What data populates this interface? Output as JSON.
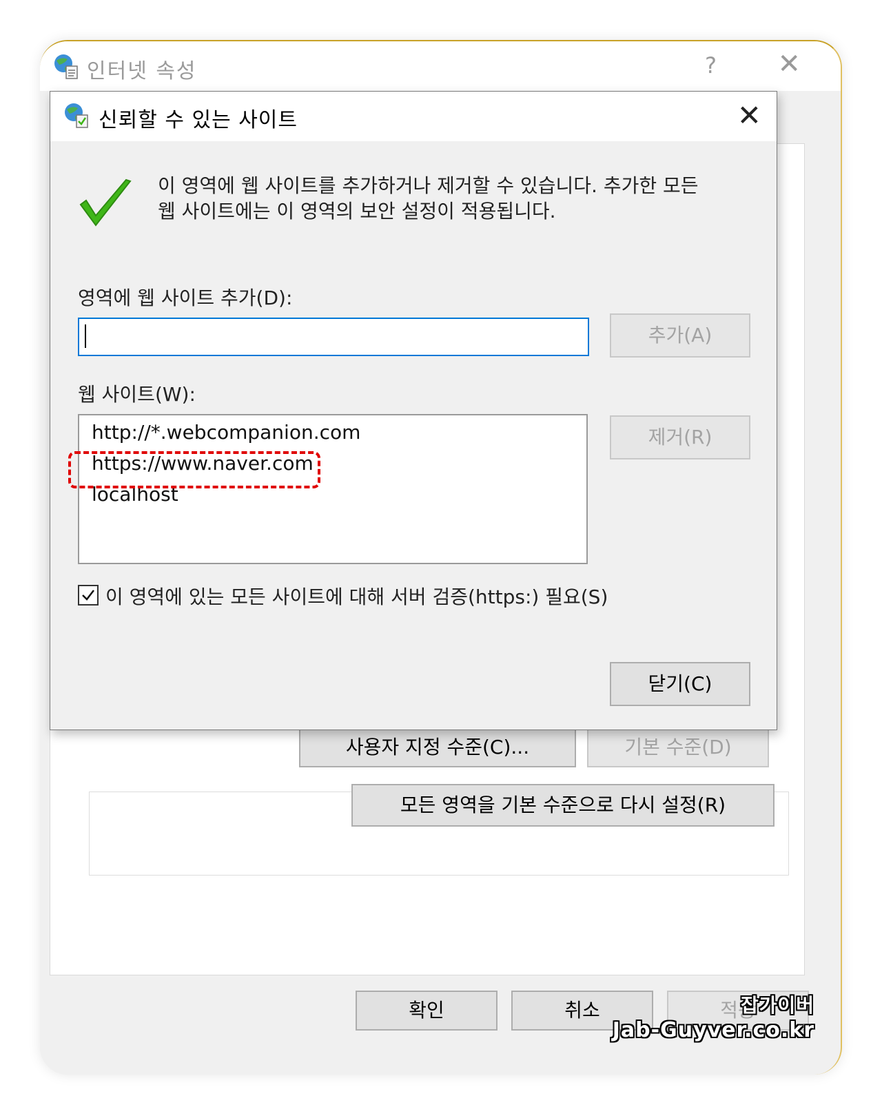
{
  "parent_window": {
    "title": "인터넷 속성",
    "help_glyph": "?",
    "close_glyph": "✕",
    "custom_level_button": "사용자 지정 수준(C)...",
    "default_level_button": "기본 수준(D)",
    "reset_all_button": "모든 영역을 기본 수준으로 다시 설정(R)",
    "ok_button": "확인",
    "cancel_button": "취소",
    "apply_button": "적용"
  },
  "dialog": {
    "title": "신뢰할 수 있는 사이트",
    "close_glyph": "✕",
    "description_line1": "이 영역에 웹 사이트를 추가하거나 제거할 수 있습니다. 추가한 모든",
    "description_line2": "웹 사이트에는 이 영역의 보안 설정이 적용됩니다.",
    "add_label": "영역에 웹 사이트 추가(D):",
    "add_input_value": "",
    "add_button": "추가(A)",
    "websites_label": "웹 사이트(W):",
    "websites": [
      "http://*.webcompanion.com",
      "https://www.naver.com",
      "localhost"
    ],
    "remove_button": "제거(R)",
    "require_https_checked": true,
    "require_https_label": "이 영역에 있는 모든 사이트에 대해 서버 검증(https:) 필요(S)",
    "close_button": "닫기(C)"
  },
  "watermark": {
    "korean": "잡가이버",
    "url": "Jab-Guyver.co.kr"
  },
  "colors": {
    "focus_border": "#0078d7",
    "highlight_dash": "#e00000",
    "check_green": "#3fb618"
  }
}
